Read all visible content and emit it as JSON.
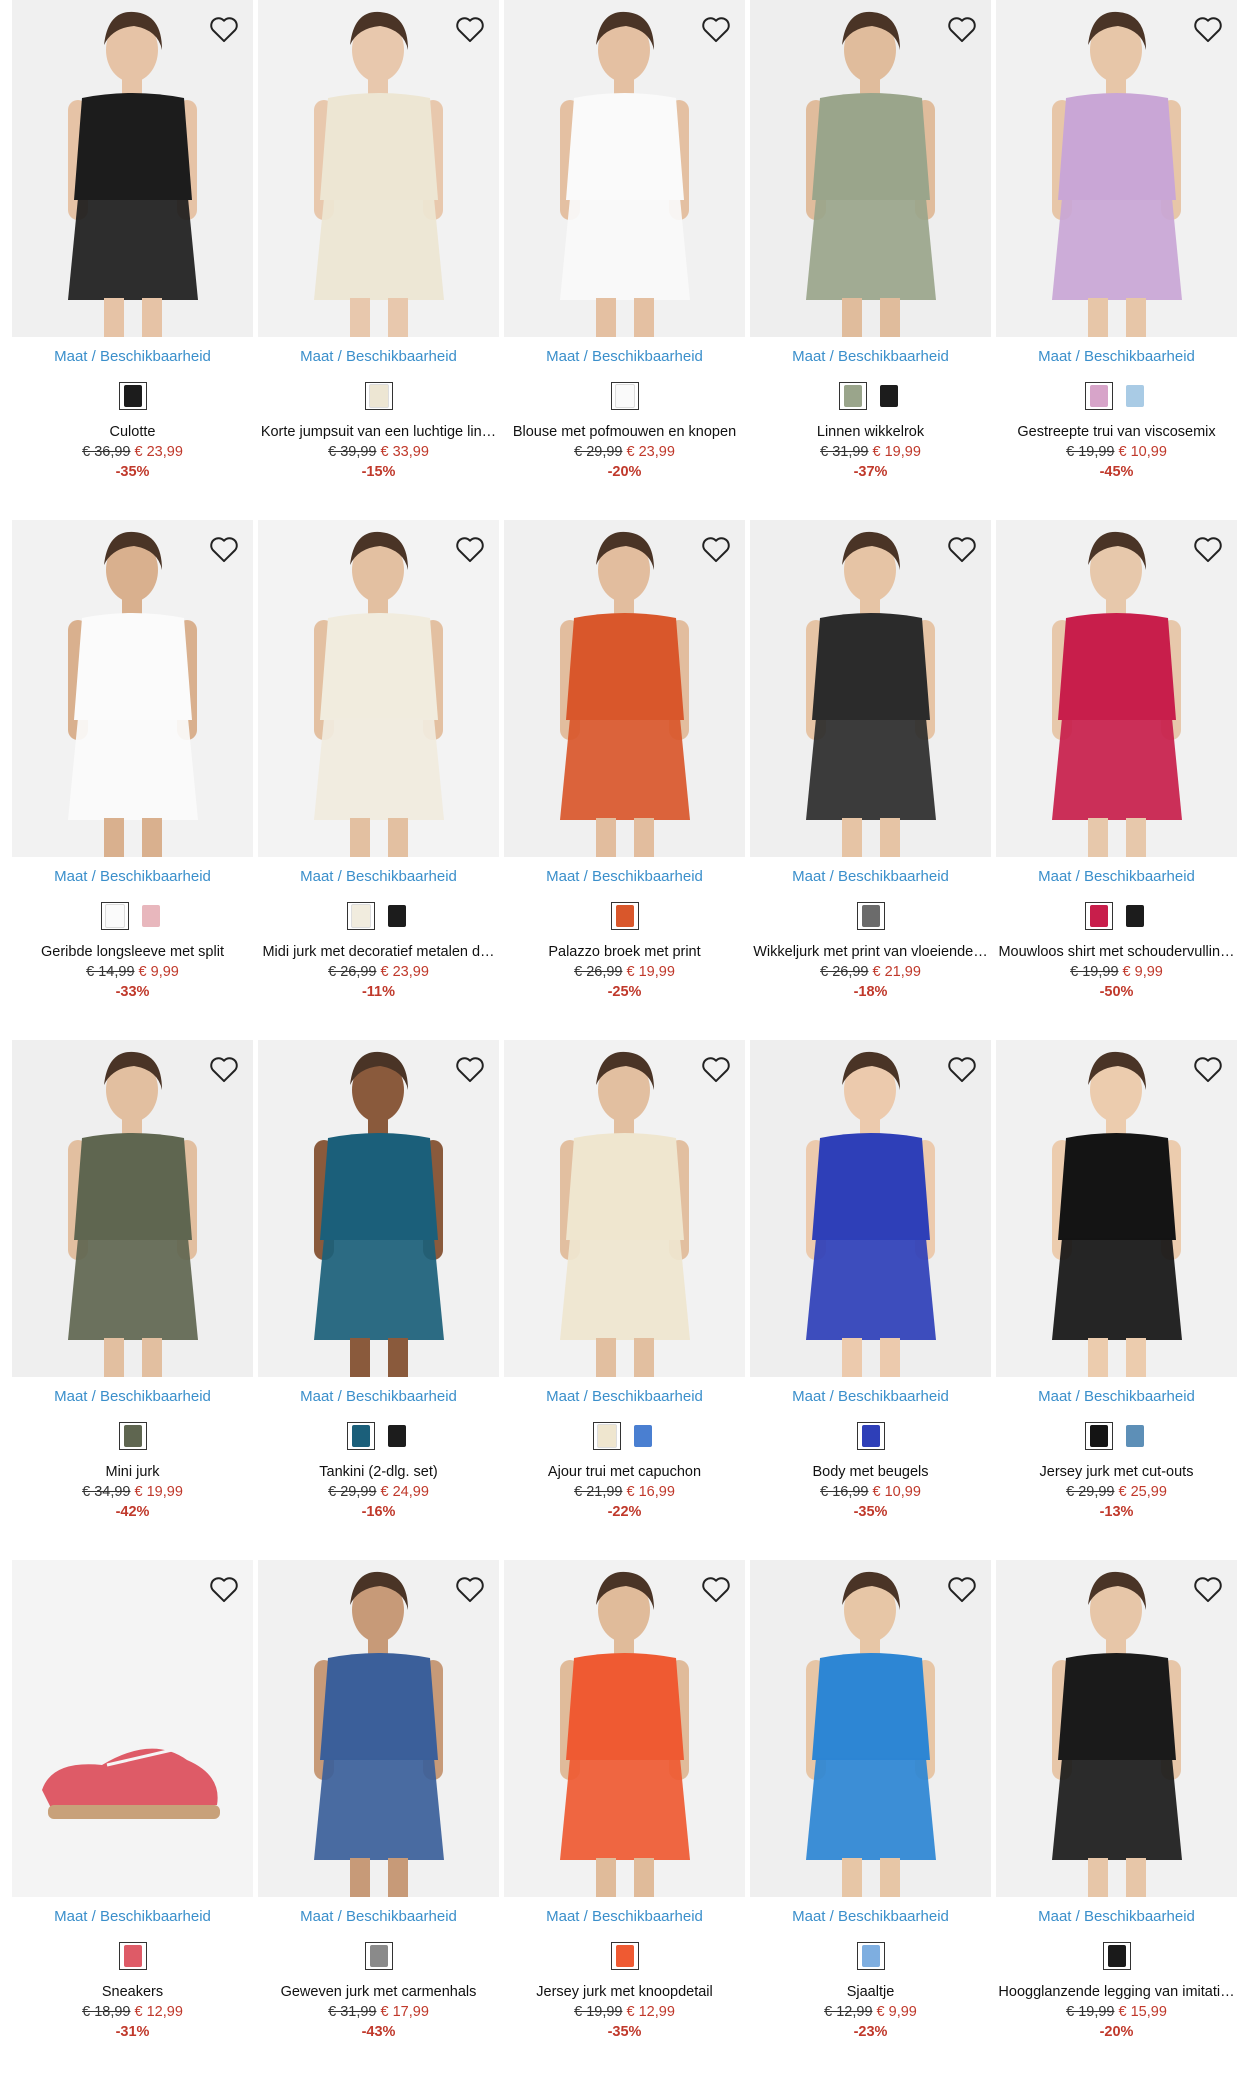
{
  "availability_label": "Maat / Beschikbaarheid",
  "products": [
    {
      "name": "Culotte",
      "old_price": "€ 36,99",
      "new_price": "€ 23,99",
      "discount": "-35%",
      "bg": "#f0f0f0",
      "garment": "#1c1c1c",
      "skin": "#e6c3a6",
      "swatches": [
        "#1c1c1c"
      ]
    },
    {
      "name": "Korte jumpsuit van een luchtige lin…",
      "old_price": "€ 39,99",
      "new_price": "€ 33,99",
      "discount": "-15%",
      "bg": "#f2f2f2",
      "garment": "#ede6d3",
      "skin": "#e8c8ad",
      "swatches": [
        "#ede6d3"
      ]
    },
    {
      "name": "Blouse met pofmouwen en knopen",
      "old_price": "€ 29,99",
      "new_price": "€ 23,99",
      "discount": "-20%",
      "bg": "#f1f1f1",
      "garment": "#fafafa",
      "skin": "#e4c0a2",
      "swatches": [
        "#fafafa"
      ]
    },
    {
      "name": "Linnen wikkelrok",
      "old_price": "€ 31,99",
      "new_price": "€ 19,99",
      "discount": "-37%",
      "bg": "#eeeeee",
      "garment": "#9aa58b",
      "skin": "#e0bc9c",
      "swatches": [
        "#9aa58b",
        "#1c1c1c"
      ]
    },
    {
      "name": "Gestreepte trui van viscosemix",
      "old_price": "€ 19,99",
      "new_price": "€ 10,99",
      "discount": "-45%",
      "bg": "#f1f1f1",
      "garment": "#c9a6d6",
      "skin": "#e7c6a8",
      "swatches": [
        "#d7a4c9",
        "#a9cbe5"
      ]
    },
    {
      "name": "Geribde longsleeve met split",
      "old_price": "€ 14,99",
      "new_price": "€ 9,99",
      "discount": "-33%",
      "bg": "#f2f2f2",
      "garment": "#fbfbfb",
      "skin": "#d9b08e",
      "swatches": [
        "#fbfbfb",
        "#e8b7bd"
      ]
    },
    {
      "name": "Midi jurk met decoratief metalen d…",
      "old_price": "€ 26,99",
      "new_price": "€ 23,99",
      "discount": "-11%",
      "bg": "#f3f3f3",
      "garment": "#f1ecde",
      "skin": "#e3c0a1",
      "swatches": [
        "#f1ecde",
        "#1c1c1c"
      ]
    },
    {
      "name": "Palazzo broek met print",
      "old_price": "€ 26,99",
      "new_price": "€ 19,99",
      "discount": "-25%",
      "bg": "#f0f0f0",
      "garment": "#d9572b",
      "skin": "#e2bd9e",
      "swatches": [
        "#d9572b"
      ]
    },
    {
      "name": "Wikkeljurk met print van vloeiende…",
      "old_price": "€ 26,99",
      "new_price": "€ 21,99",
      "discount": "-18%",
      "bg": "#efefef",
      "garment": "#2b2b2b",
      "skin": "#e6c4a5",
      "swatches": [
        "#6b6b6b"
      ]
    },
    {
      "name": "Mouwloos shirt met schoudervullin…",
      "old_price": "€ 19,99",
      "new_price": "€ 9,99",
      "discount": "-50%",
      "bg": "#f1f1f1",
      "garment": "#c81e4b",
      "skin": "#e7c8ab",
      "swatches": [
        "#c81e4b",
        "#1c1c1c"
      ]
    },
    {
      "name": "Mini jurk",
      "old_price": "€ 34,99",
      "new_price": "€ 19,99",
      "discount": "-42%",
      "bg": "#efefef",
      "garment": "#5f6650",
      "skin": "#e2bfa0",
      "swatches": [
        "#5f6650"
      ]
    },
    {
      "name": "Tankini (2-dlg. set)",
      "old_price": "€ 29,99",
      "new_price": "€ 24,99",
      "discount": "-16%",
      "bg": "#f1f1f1",
      "garment": "#1b5f7a",
      "skin": "#8a5a3c",
      "swatches": [
        "#1b5f7a",
        "#1c1c1c"
      ]
    },
    {
      "name": "Ajour trui met capuchon",
      "old_price": "€ 21,99",
      "new_price": "€ 16,99",
      "discount": "-22%",
      "bg": "#f2f2f2",
      "garment": "#efe6cf",
      "skin": "#e2bfa0",
      "swatches": [
        "#efe6cf",
        "#4a7fd1"
      ]
    },
    {
      "name": "Body met beugels",
      "old_price": "€ 16,99",
      "new_price": "€ 10,99",
      "discount": "-35%",
      "bg": "#eeeeee",
      "garment": "#2e3fb8",
      "skin": "#eccaad",
      "swatches": [
        "#2e3fb8"
      ]
    },
    {
      "name": "Jersey jurk met cut-outs",
      "old_price": "€ 29,99",
      "new_price": "€ 25,99",
      "discount": "-13%",
      "bg": "#f1f1f1",
      "garment": "#141414",
      "skin": "#ecccae",
      "swatches": [
        "#141414",
        "#5d8fb7"
      ]
    },
    {
      "name": "Sneakers",
      "old_price": "€ 18,99",
      "new_price": "€ 12,99",
      "discount": "-31%",
      "bg": "#f4f4f4",
      "garment": "#de5b67",
      "skin": "#c8a17a",
      "swatches": [
        "#de5b67"
      ]
    },
    {
      "name": "Geweven jurk met carmenhals",
      "old_price": "€ 31,99",
      "new_price": "€ 17,99",
      "discount": "-43%",
      "bg": "#f1f1f1",
      "garment": "#3b5f9a",
      "skin": "#c79a78",
      "swatches": [
        "#8a8a8a"
      ]
    },
    {
      "name": "Jersey jurk met knoopdetail",
      "old_price": "€ 19,99",
      "new_price": "€ 12,99",
      "discount": "-35%",
      "bg": "#f2f2f2",
      "garment": "#ef5a32",
      "skin": "#e0bb9a",
      "swatches": [
        "#ef5a32"
      ]
    },
    {
      "name": "Sjaaltje",
      "old_price": "€ 12,99",
      "new_price": "€ 9,99",
      "discount": "-23%",
      "bg": "#efefef",
      "garment": "#2d86d4",
      "skin": "#e7c6a6",
      "swatches": [
        "#7eaee0"
      ]
    },
    {
      "name": "Hoogglanzende legging van imitati…",
      "old_price": "€ 19,99",
      "new_price": "€ 15,99",
      "discount": "-20%",
      "bg": "#f1f1f1",
      "garment": "#1a1a1a",
      "skin": "#e7c6a8",
      "swatches": [
        "#1a1a1a"
      ]
    }
  ]
}
